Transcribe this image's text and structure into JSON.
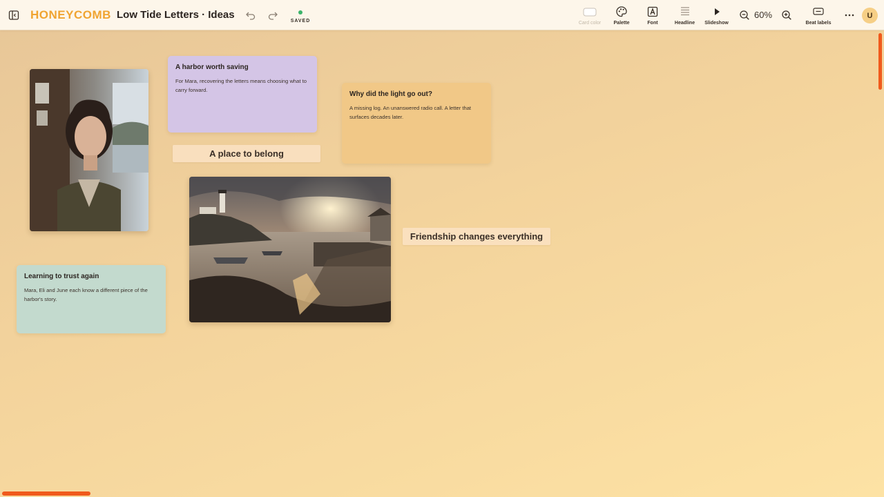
{
  "app": {
    "logo": "HONEYCOMB",
    "title": "Low Tide Letters · Ideas",
    "save_status": "SAVED",
    "status_color": "#3bb36a"
  },
  "toolbar": {
    "card_color": "Card color",
    "palette": "Palette",
    "font": "Font",
    "headline": "Headline",
    "slideshow": "Slideshow",
    "zoom": "60%",
    "beat_labels": "Beat labels",
    "avatar": "U"
  },
  "icons": {
    "sidebar_toggle": "sidebar-toggle-icon",
    "undo": "undo-icon",
    "redo": "redo-icon",
    "palette": "palette-icon",
    "font": "font-icon",
    "headline": "headline-icon",
    "slideshow": "play-icon",
    "zoom_out": "zoom-out-icon",
    "zoom_in": "zoom-in-icon",
    "beat_labels": "beat-labels-icon",
    "more": "more-icon"
  },
  "cards": [
    {
      "title": "A harbor worth saving",
      "body": "For Mara, recovering the letters means choosing what to carry forward.",
      "color": "#d4c5e6"
    },
    {
      "title": "Why did the light go out?",
      "body": "A missing log. An unanswered radio call. A letter that surfaces decades later.",
      "color": "#f1c887"
    },
    {
      "title": "Learning to trust again",
      "body": "Mara, Eli and June each know a different piece of the harbor's story.",
      "color": "#c3dace"
    }
  ],
  "headlines": [
    "A place to belong",
    "Friendship changes everything"
  ],
  "colors": {
    "accent": "#f0a431",
    "scrollbar": "#f05a1c",
    "topbar": "#fdf6ea"
  }
}
